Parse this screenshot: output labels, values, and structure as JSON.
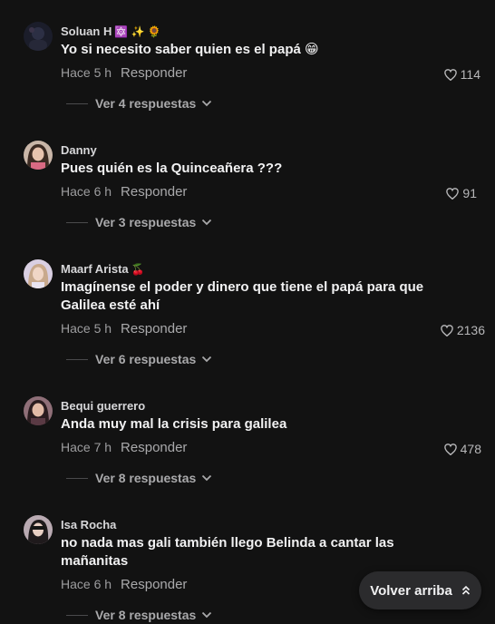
{
  "comments": [
    {
      "username": "Soluan H",
      "badges": "🔯 ✨ 🌻",
      "text": "Yo si necesito saber quien es el papá 😁",
      "time": "Hace 5 h",
      "reply": "Responder",
      "likes": "114",
      "view_replies": "Ver 4 respuestas"
    },
    {
      "username": "Danny",
      "badges": "",
      "text": "Pues quién es la Quinceañera ???",
      "time": "Hace 6 h",
      "reply": "Responder",
      "likes": "91",
      "view_replies": "Ver 3 respuestas"
    },
    {
      "username": "Maarf Arista",
      "badges": "🍒",
      "text": "Imagínense el poder y dinero que tiene el papá para que Galilea esté ahí",
      "time": "Hace 5 h",
      "reply": "Responder",
      "likes": "2136",
      "view_replies": "Ver 6 respuestas"
    },
    {
      "username": "Bequi guerrero",
      "badges": "",
      "text": "Anda muy mal la crisis para galilea",
      "time": "Hace 7 h",
      "reply": "Responder",
      "likes": "478",
      "view_replies": "Ver 8 respuestas"
    },
    {
      "username": "Isa Rocha",
      "badges": "",
      "text": "no nada mas gali también llego Belinda a cantar las mañanitas",
      "time": "Hace 6 h",
      "reply": "Responder",
      "likes": "",
      "view_replies": "Ver 8 respuestas"
    }
  ],
  "back_to_top": {
    "label": "Volver arriba",
    "icon": "double-chevron-up-icon"
  },
  "colors": {
    "background": "#121212",
    "text_primary": "#f1f1f2",
    "text_secondary": "#9d9d9f",
    "button_bg": "#2b2b2d"
  }
}
